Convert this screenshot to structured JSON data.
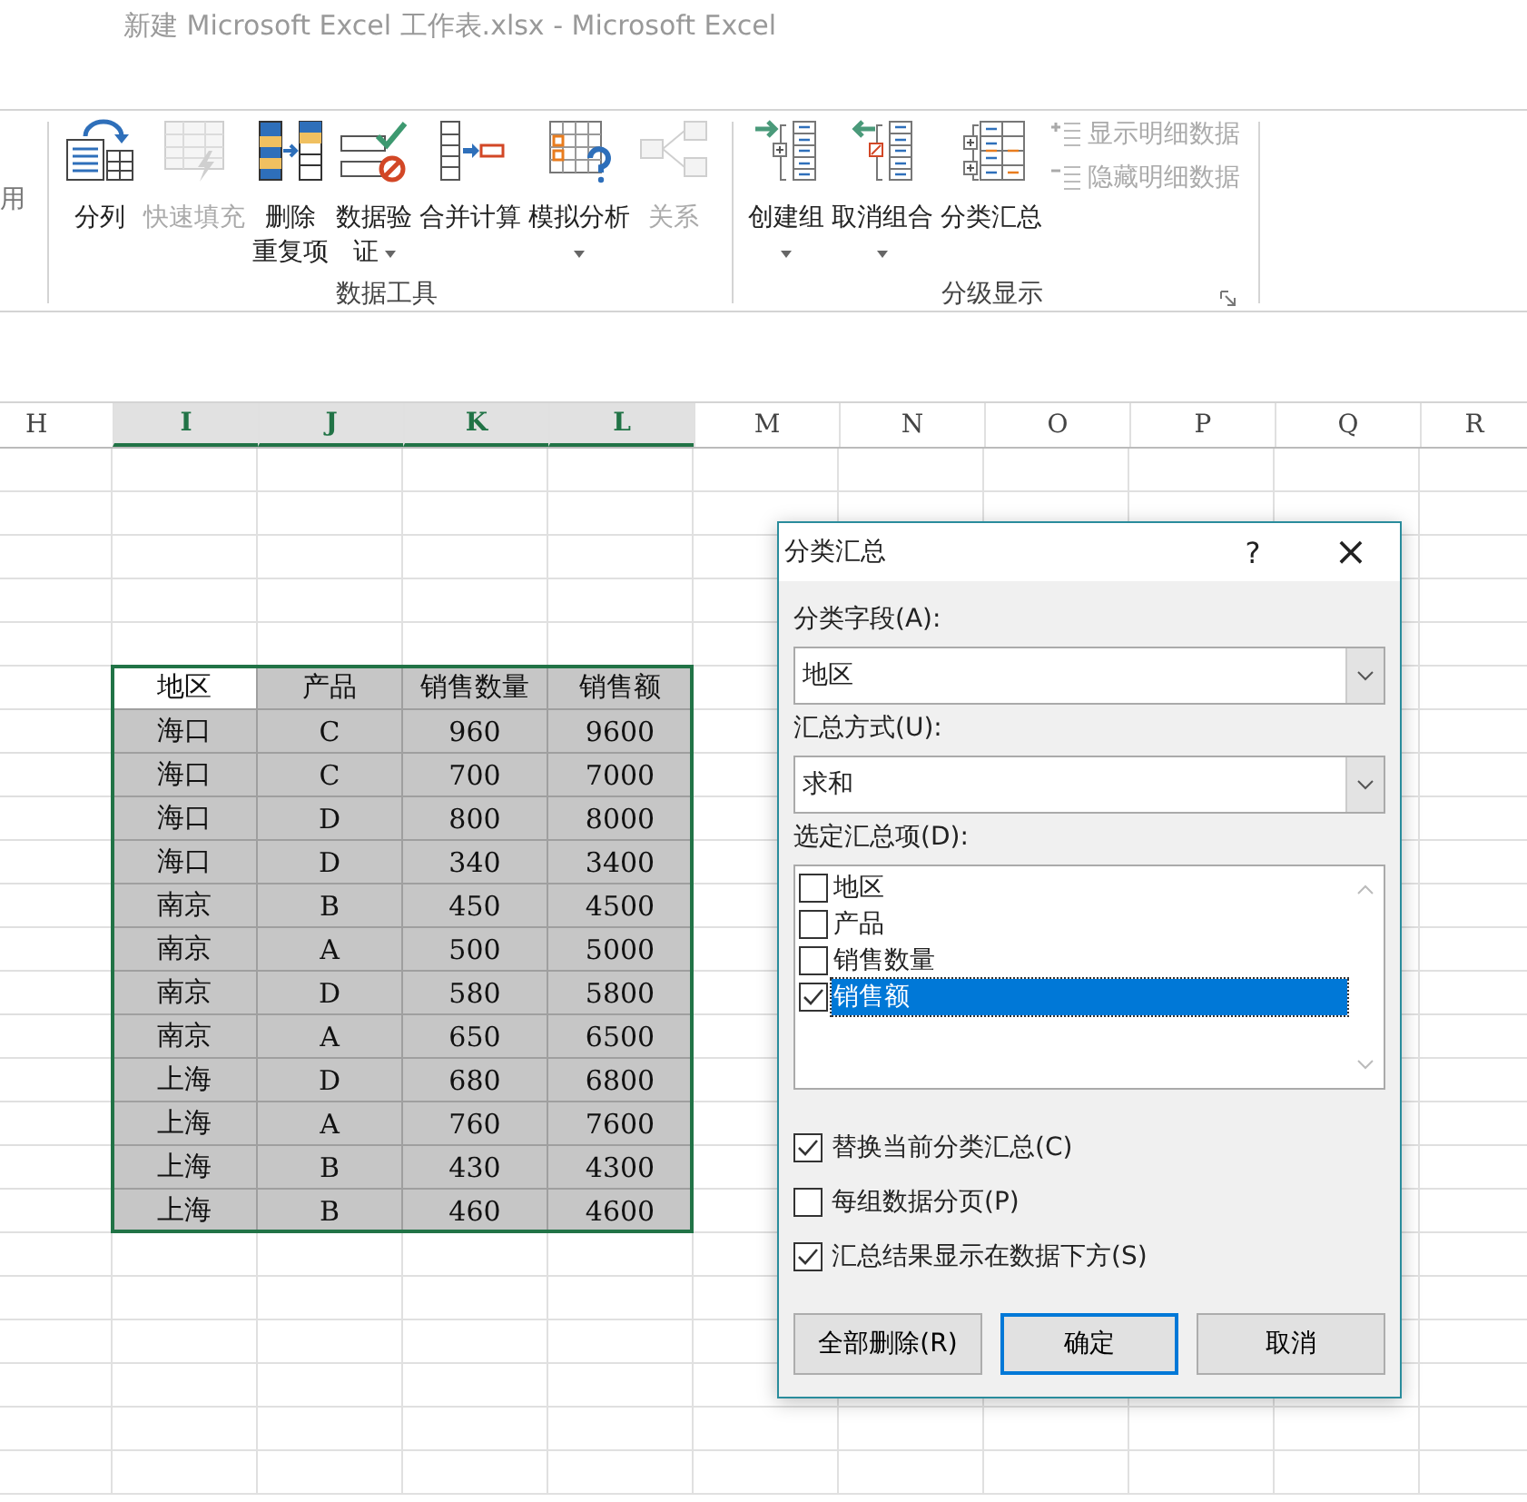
{
  "window": {
    "title": "新建 Microsoft Excel 工作表.xlsx - Microsoft Excel"
  },
  "ribbon": {
    "partial_label": "用",
    "groups": [
      {
        "label": "数据工具",
        "launcher": false,
        "buttons": [
          {
            "kind": "split",
            "lines": [
              "分列"
            ],
            "disabled": false,
            "dropdown": false
          },
          {
            "kind": "flashfill",
            "lines": [
              "快速填充"
            ],
            "disabled": true,
            "dropdown": false
          },
          {
            "kind": "dedupe",
            "lines": [
              "删除",
              "重复项"
            ],
            "disabled": false,
            "dropdown": false
          },
          {
            "kind": "validate",
            "lines": [
              "数据验",
              "证"
            ],
            "disabled": false,
            "dropdown": true
          },
          {
            "kind": "consolidate",
            "lines": [
              "合并计算"
            ],
            "disabled": false,
            "dropdown": false
          },
          {
            "kind": "whatif",
            "lines": [
              "模拟分析"
            ],
            "disabled": false,
            "dropdown": true
          },
          {
            "kind": "relations",
            "lines": [
              "关系"
            ],
            "disabled": true,
            "dropdown": false
          }
        ]
      },
      {
        "label": "分级显示",
        "launcher": true,
        "buttons": [
          {
            "kind": "group",
            "lines": [
              "创建组"
            ],
            "disabled": false,
            "dropdown": true
          },
          {
            "kind": "ungroup",
            "lines": [
              "取消组合"
            ],
            "disabled": false,
            "dropdown": true
          },
          {
            "kind": "subtotal",
            "lines": [
              "分类汇总"
            ],
            "disabled": false,
            "dropdown": false
          }
        ],
        "small_buttons": [
          {
            "kind": "show",
            "label": "显示明细数据",
            "disabled": true
          },
          {
            "kind": "hide",
            "label": "隐藏明细数据",
            "disabled": true
          }
        ]
      }
    ]
  },
  "sheet": {
    "column_headers": [
      {
        "label": "H",
        "selected": false
      },
      {
        "label": "I",
        "selected": true
      },
      {
        "label": "J",
        "selected": true
      },
      {
        "label": "K",
        "selected": true
      },
      {
        "label": "L",
        "selected": true
      },
      {
        "label": "M",
        "selected": false
      },
      {
        "label": "N",
        "selected": false
      },
      {
        "label": "O",
        "selected": false
      },
      {
        "label": "P",
        "selected": false
      },
      {
        "label": "Q",
        "selected": false
      },
      {
        "label": "R",
        "selected": false
      }
    ],
    "table": {
      "header": [
        {
          "text": "地区",
          "active": true
        },
        {
          "text": "产品",
          "active": false
        },
        {
          "text": "销售数量",
          "active": false
        },
        {
          "text": "销售额",
          "active": false
        }
      ],
      "rows": [
        [
          "海口",
          "C",
          "960",
          "9600"
        ],
        [
          "海口",
          "C",
          "700",
          "7000"
        ],
        [
          "海口",
          "D",
          "800",
          "8000"
        ],
        [
          "海口",
          "D",
          "340",
          "3400"
        ],
        [
          "南京",
          "B",
          "450",
          "4500"
        ],
        [
          "南京",
          "A",
          "500",
          "5000"
        ],
        [
          "南京",
          "D",
          "580",
          "5800"
        ],
        [
          "南京",
          "A",
          "650",
          "6500"
        ],
        [
          "上海",
          "D",
          "680",
          "6800"
        ],
        [
          "上海",
          "A",
          "760",
          "7600"
        ],
        [
          "上海",
          "B",
          "430",
          "4300"
        ],
        [
          "上海",
          "B",
          "460",
          "4600"
        ]
      ]
    }
  },
  "dialog": {
    "title": "分类汇总",
    "help": "?",
    "close": "×",
    "group_by": {
      "label": "分类字段(A):",
      "value": "地区"
    },
    "function": {
      "label": "汇总方式(U):",
      "value": "求和"
    },
    "items_label": "选定汇总项(D):",
    "items": [
      {
        "label": "地区",
        "checked": false,
        "selected": false
      },
      {
        "label": "产品",
        "checked": false,
        "selected": false
      },
      {
        "label": "销售数量",
        "checked": false,
        "selected": false
      },
      {
        "label": "销售额",
        "checked": true,
        "selected": true
      }
    ],
    "options": [
      {
        "label": "替换当前分类汇总(C)",
        "checked": true
      },
      {
        "label": "每组数据分页(P)",
        "checked": false
      },
      {
        "label": "汇总结果显示在数据下方(S)",
        "checked": true
      }
    ],
    "buttons": [
      {
        "label": "全部删除(R)",
        "default": false
      },
      {
        "label": "确定",
        "default": true
      },
      {
        "label": "取消",
        "default": false
      }
    ]
  }
}
